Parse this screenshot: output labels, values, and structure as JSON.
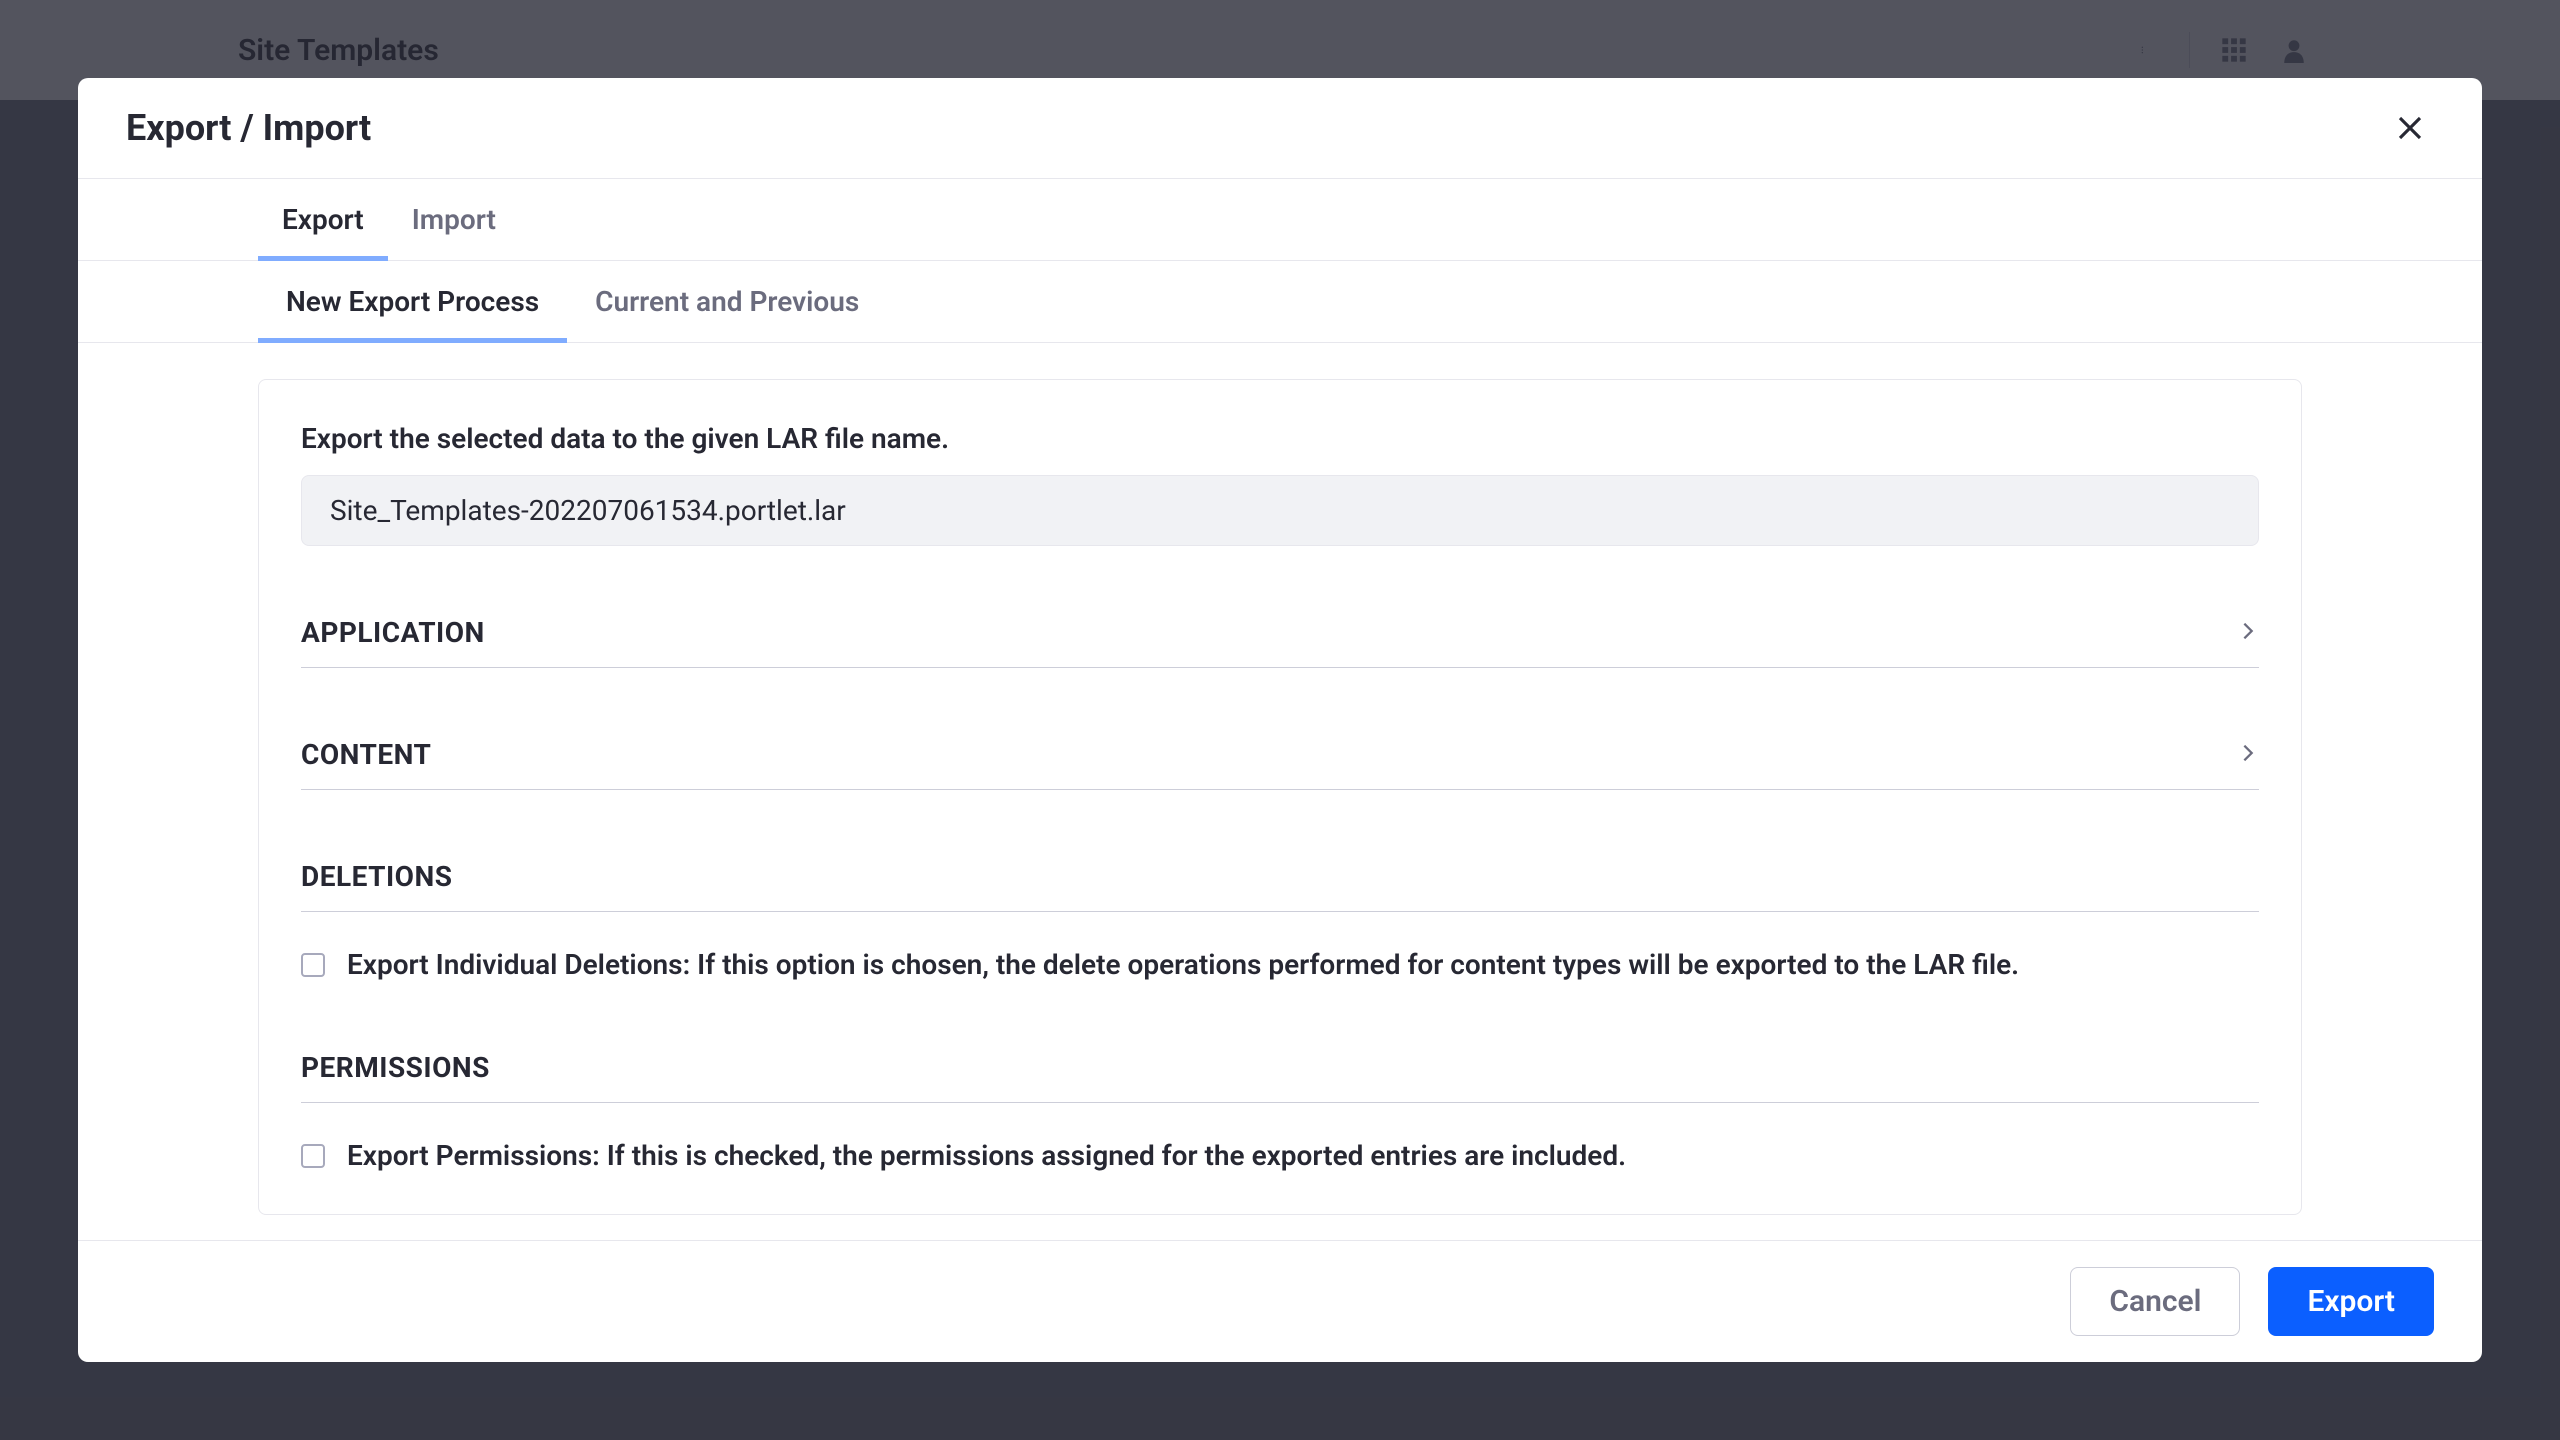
{
  "backdrop": {
    "title": "Site Templates"
  },
  "modal": {
    "title": "Export / Import",
    "primary_tabs": [
      {
        "label": "Export",
        "active": true
      },
      {
        "label": "Import",
        "active": false
      }
    ],
    "sub_tabs": [
      {
        "label": "New Export Process",
        "active": true
      },
      {
        "label": "Current and Previous",
        "active": false
      }
    ],
    "filename_label": "Export the selected data to the given LAR file name.",
    "filename_value": "Site_Templates-202207061534.portlet.lar",
    "sections": {
      "application": {
        "title": "APPLICATION"
      },
      "content": {
        "title": "CONTENT"
      },
      "deletions": {
        "title": "DELETIONS",
        "checkbox_label": "Export Individual Deletions: If this option is chosen, the delete operations performed for content types will be exported to the LAR file."
      },
      "permissions": {
        "title": "PERMISSIONS",
        "checkbox_label": "Export Permissions: If this is checked, the permissions assigned for the exported entries are included."
      }
    },
    "footer": {
      "cancel_label": "Cancel",
      "export_label": "Export"
    }
  }
}
